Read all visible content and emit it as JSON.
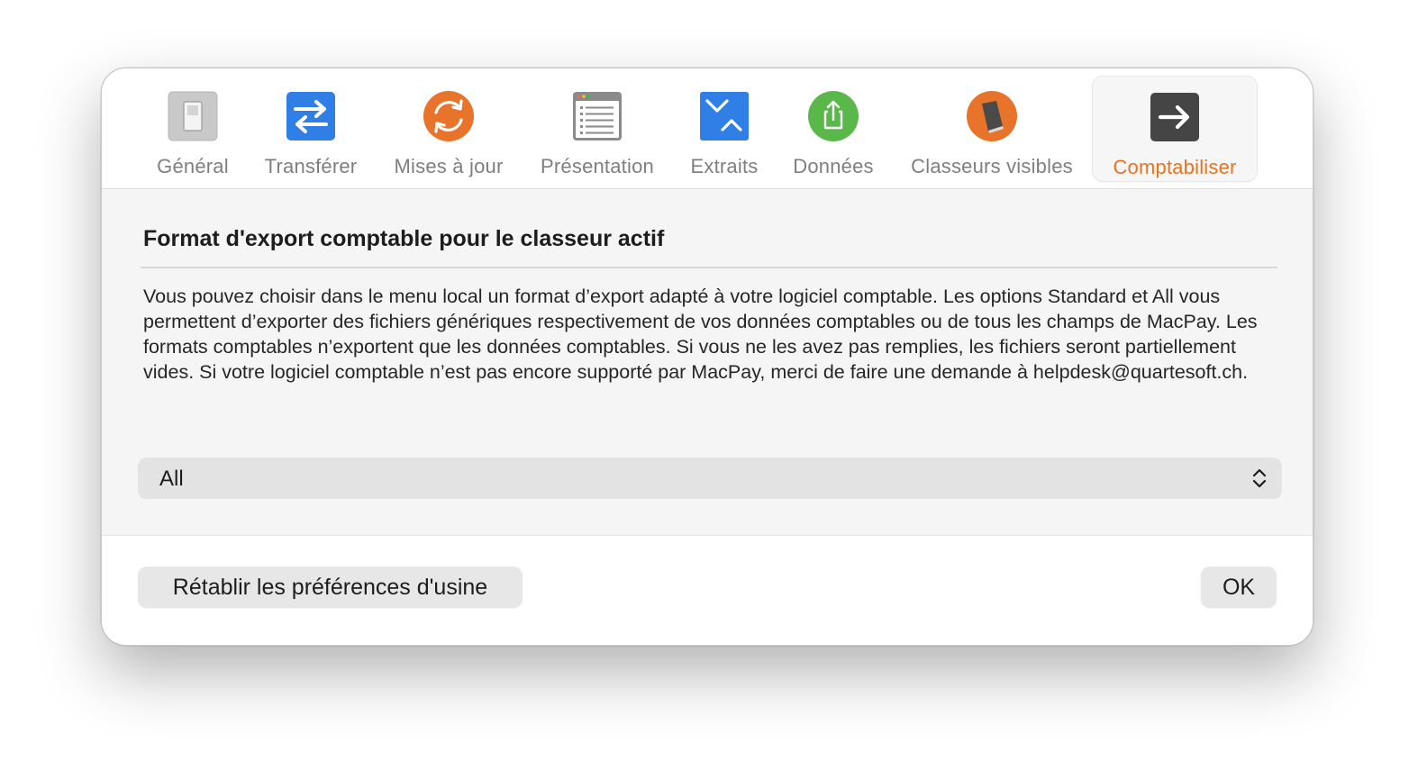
{
  "toolbar": {
    "tabs": [
      {
        "label": "Général",
        "icon": "switch-icon"
      },
      {
        "label": "Transférer",
        "icon": "transfer-arrows-icon"
      },
      {
        "label": "Mises à jour",
        "icon": "refresh-icon"
      },
      {
        "label": "Présentation",
        "icon": "list-window-icon"
      },
      {
        "label": "Extraits",
        "icon": "envelope-icon"
      },
      {
        "label": "Données",
        "icon": "share-icon"
      },
      {
        "label": "Classeurs visibles",
        "icon": "book-icon"
      },
      {
        "label": "Comptabiliser",
        "icon": "arrow-right-icon",
        "selected": true
      }
    ]
  },
  "section": {
    "title": "Format d'export comptable pour le classeur actif",
    "description": "Vous pouvez choisir dans le menu local un format d’export adapté à votre logiciel comptable. Les options Standard et All vous permettent d’exporter des fichiers génériques respectivement de vos données comptables ou de tous les champs de MacPay. Les formats comptables n’exportent que les données comptables. Si vous ne les avez pas remplies, les fichiers seront partiellement vides. Si votre logiciel comptable n’est pas encore supporté par MacPay, merci de faire une demande à helpdesk@quartesoft.ch."
  },
  "format_select": {
    "value": "All"
  },
  "footer": {
    "reset_label": "Rétablir les préférences d'usine",
    "ok_label": "OK"
  },
  "colors": {
    "accent": "#e8731f",
    "transfer_blue": "#2f7fe6",
    "update_orange": "#e8732b",
    "data_green": "#5ab84a"
  }
}
